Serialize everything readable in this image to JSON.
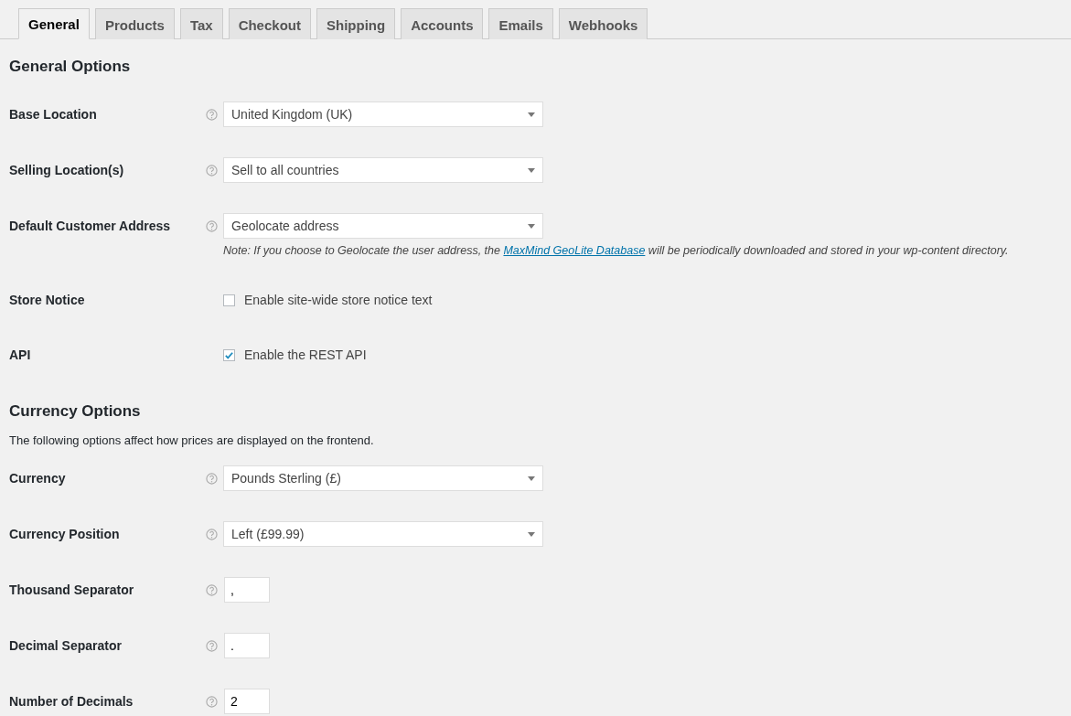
{
  "tabs": [
    {
      "label": "General",
      "selected": true
    },
    {
      "label": "Products",
      "selected": false
    },
    {
      "label": "Tax",
      "selected": false
    },
    {
      "label": "Checkout",
      "selected": false
    },
    {
      "label": "Shipping",
      "selected": false
    },
    {
      "label": "Accounts",
      "selected": false
    },
    {
      "label": "Emails",
      "selected": false
    },
    {
      "label": "Webhooks",
      "selected": false
    }
  ],
  "sections": [
    {
      "title": "General Options",
      "rows": [
        {
          "label": "Base Location",
          "help": true,
          "kind": "select",
          "value": "United Kingdom (UK)"
        },
        {
          "label": "Selling Location(s)",
          "help": true,
          "kind": "select",
          "value": "Sell to all countries"
        },
        {
          "label": "Default Customer Address",
          "help": true,
          "kind": "select",
          "value": "Geolocate address",
          "note": {
            "before": "Note: If you choose to Geolocate the user address, the",
            "link": "MaxMind GeoLite Database",
            "after": "will be periodically downloaded and stored in your wp-content directory."
          }
        },
        {
          "label": "Store Notice",
          "help": false,
          "kind": "checkbox",
          "text": "Enable site-wide store notice text",
          "checked": false
        },
        {
          "label": "API",
          "help": false,
          "kind": "checkbox",
          "text": "Enable the REST API",
          "checked": true
        }
      ]
    },
    {
      "title": "Currency Options",
      "description": "The following options affect how prices are displayed on the frontend.",
      "rows": [
        {
          "label": "Currency",
          "help": true,
          "kind": "select",
          "value": "Pounds Sterling (£)"
        },
        {
          "label": "Currency Position",
          "help": true,
          "kind": "select",
          "value": "Left (£99.99)"
        },
        {
          "label": "Thousand Separator",
          "help": true,
          "kind": "text",
          "value": ","
        },
        {
          "label": "Decimal Separator",
          "help": true,
          "kind": "text",
          "value": "."
        },
        {
          "label": "Number of Decimals",
          "help": true,
          "kind": "number",
          "value": "2"
        }
      ]
    }
  ]
}
